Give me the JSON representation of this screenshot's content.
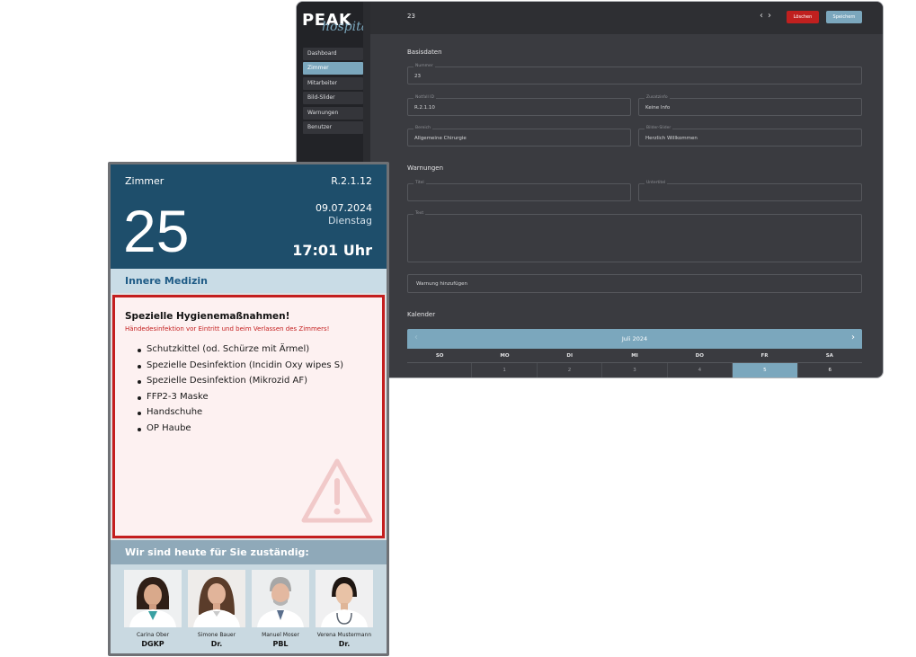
{
  "admin": {
    "logo_main": "PEAK",
    "logo_sub": "hospital",
    "nav": [
      {
        "label": "Dashboard",
        "active": false
      },
      {
        "label": "Zimmer",
        "active": true
      },
      {
        "label": "Mitarbeiter",
        "active": false
      },
      {
        "label": "Bild-Slider",
        "active": false
      },
      {
        "label": "Warnungen",
        "active": false
      },
      {
        "label": "Benutzer",
        "active": false
      }
    ],
    "topbar": {
      "room_number": "23",
      "prev_icon": "chevron-left-icon",
      "next_icon": "chevron-right-icon",
      "delete_label": "Löschen",
      "save_label": "Speichern"
    },
    "basisdaten": {
      "title": "Basisdaten",
      "nummer_label": "Nummer",
      "nummer_value": "23",
      "notfall_label": "Notfall ID",
      "notfall_value": "R.2.1.10",
      "zusatz_label": "Zusatzinfo",
      "zusatz_value": "Keine Info",
      "bereich_label": "Bereich",
      "bereich_value": "Allgemeine Chirurgie",
      "slider_label": "Bilder-Slider",
      "slider_value": "Herzlich Willkommen"
    },
    "warnungen": {
      "title": "Warnungen",
      "titel_label": "Titel",
      "untertitel_label": "Untertitel",
      "text_label": "Text",
      "add_label": "Warnung hinzufügen"
    },
    "kalender": {
      "title": "Kalender",
      "month": "Juli 2024",
      "weekdays": [
        "SO",
        "MO",
        "DI",
        "MI",
        "DO",
        "FR",
        "SA"
      ],
      "dates": [
        "",
        "1",
        "2",
        "3",
        "4",
        "5",
        "6"
      ],
      "today_index": 5
    },
    "colors": {
      "accent": "#7ba7bd",
      "danger": "#c0201f",
      "bg": "#3a3b40",
      "sidebar": "#222327"
    }
  },
  "tablet": {
    "zimmer_label": "Zimmer",
    "room_id": "R.2.1.12",
    "room_number": "25",
    "date": "09.07.2024",
    "weekday": "Dienstag",
    "time": "17:01 Uhr",
    "department": "Innere Medizin",
    "warning": {
      "title": "Spezielle Hygienemaßnahmen!",
      "subtitle": "Händedesinfektion vor Eintritt und beim Verlassen des Zimmers!",
      "items": [
        "Schutzkittel (od. Schürze mit Ärmel)",
        "Spezielle Desinfektion (Incidin Oxy wipes S)",
        "Spezielle Desinfektion (Mikrozid AF)",
        "FFP2-3 Maske",
        "Handschuhe",
        "OP Haube"
      ],
      "icon": "warning-triangle-icon"
    },
    "team_title": "Wir sind heute für Sie zuständig:",
    "team": [
      {
        "name": "Carina Ober",
        "role": "DGKP"
      },
      {
        "name": "Simone Bauer",
        "role": "Dr."
      },
      {
        "name": "Manuel Moser",
        "role": "PBL"
      },
      {
        "name": "Verena Mustermann",
        "role": "Dr."
      }
    ],
    "colors": {
      "header": "#1e4e6b",
      "warning_border": "#c41e1e",
      "warning_bg": "#fdf1f1"
    }
  }
}
